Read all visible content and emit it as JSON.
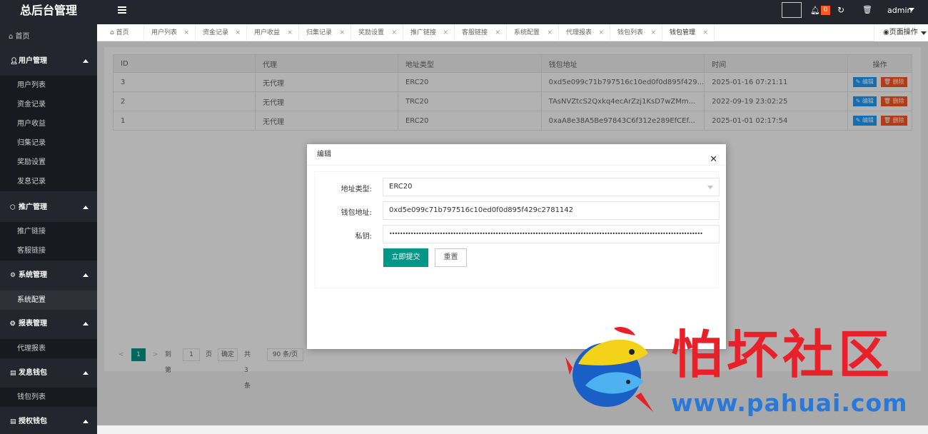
{
  "app": {
    "title": "总后台管理",
    "admin_label": "admin",
    "notif_count": "0"
  },
  "sidebar": {
    "home": "首页",
    "groups": [
      {
        "label": "用户管理",
        "items": [
          "用户列表",
          "资金记录",
          "用户收益",
          "归集记录",
          "奖励设置",
          "发息记录"
        ]
      },
      {
        "label": "推广管理",
        "items": [
          "推广链接",
          "客服链接"
        ]
      },
      {
        "label": "系统管理",
        "items": [
          "系统配置"
        ]
      },
      {
        "label": "报表管理",
        "items": [
          "代理报表"
        ]
      },
      {
        "label": "发息钱包",
        "items": [
          "钱包列表"
        ]
      },
      {
        "label": "授权钱包",
        "items": []
      }
    ]
  },
  "tabs": [
    "首页",
    "用户列表",
    "资金记录",
    "用户收益",
    "归集记录",
    "奖励设置",
    "推广链接",
    "客服链接",
    "系统配置",
    "代理报表",
    "钱包列表",
    "钱包管理"
  ],
  "page_ops": "页面操作",
  "table": {
    "headers": [
      "ID",
      "代理",
      "地址类型",
      "钱包地址",
      "时间",
      "操作"
    ],
    "rows": [
      [
        "3",
        "无代理",
        "ERC20",
        "0xd5e099c71b797516c10ed0f0d895f429...",
        "2025-01-16 07:21:11"
      ],
      [
        "2",
        "无代理",
        "TRC20",
        "TAsNVZtcS2Qxkq4ecArZzj1KsD7wZMm...",
        "2022-09-19 23:02:25"
      ],
      [
        "1",
        "无代理",
        "ERC20",
        "0xaA8e38A5Be97843C6f312e289EfCEf...",
        "2025-01-01 02:17:54"
      ]
    ],
    "edit_label": "编辑",
    "delete_label": "删除"
  },
  "pager": {
    "current": "1",
    "goto_label": "到第",
    "page_value": "1",
    "page_unit": "页",
    "confirm": "确定",
    "total": "共 3 条",
    "per_page": "90 条/页"
  },
  "modal": {
    "title": "编辑",
    "fields": [
      {
        "label": "地址类型:",
        "value": "ERC20"
      },
      {
        "label": "钱包地址:",
        "value": "0xd5e099c71b797516c10ed0f0d895f429c2781142"
      },
      {
        "label": "私钥:",
        "value": "••••••••••••••••••••••••••••••••••••••••••••••••••••••••••••••••••••••••••••••••••••••••••••••••••••••••••••••••••••••"
      }
    ],
    "submit": "立即提交",
    "reset": "重置"
  },
  "watermark": {
    "text": "怕坏社区",
    "url": "www.pahuai.com"
  },
  "colors": {
    "sidebar_bg": "#23262e",
    "primary": "#009688",
    "edit_blue": "#1e9fff",
    "delete_orange": "#ff5722",
    "wm_red": "#e8202a",
    "wm_blue": "#2a78d8"
  }
}
